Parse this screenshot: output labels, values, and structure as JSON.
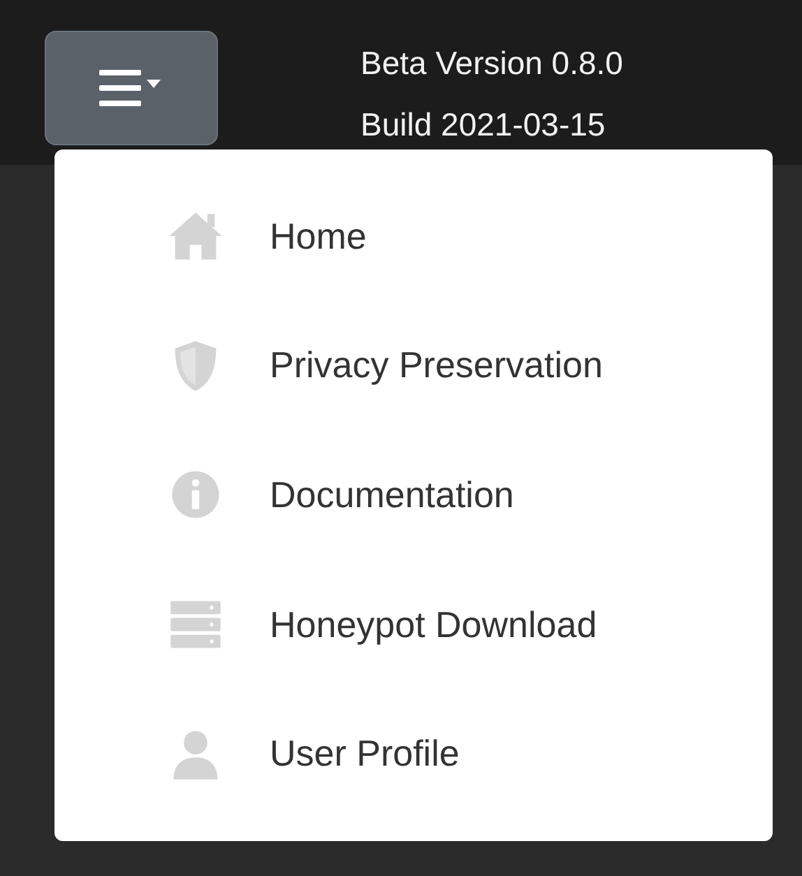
{
  "header": {
    "version": "Beta Version 0.8.0",
    "build": "Build 2021-03-15",
    "menu_expanded": true
  },
  "menu": {
    "items": [
      {
        "kind": "home",
        "label": "Home"
      },
      {
        "kind": "shield",
        "label": "Privacy Preservation"
      },
      {
        "kind": "info",
        "label": "Documentation"
      },
      {
        "kind": "server",
        "label": "Honeypot Download"
      },
      {
        "kind": "user",
        "label": "User Profile"
      }
    ]
  }
}
